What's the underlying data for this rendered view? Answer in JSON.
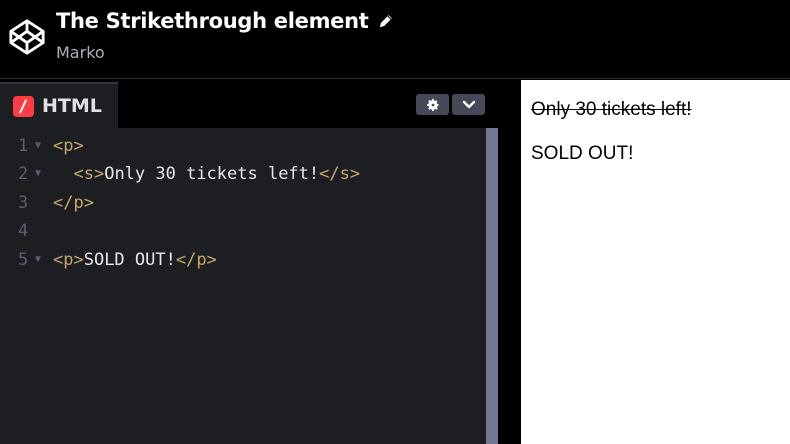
{
  "header": {
    "title": "The Strikethrough element",
    "author": "Marko",
    "logo_icon": "codepen-logo-icon",
    "edit_icon": "pencil-icon"
  },
  "editor": {
    "tab_label": "HTML",
    "tab_icon": "html-tab-icon",
    "settings_icon": "gear-icon",
    "collapse_icon": "chevron-down-icon",
    "lines": [
      {
        "num": "1",
        "fold": "▼",
        "open": "<p>",
        "text": "",
        "close": ""
      },
      {
        "num": "2",
        "fold": "▼",
        "indent": "  ",
        "open": "<s>",
        "text": "Only 30 tickets left!",
        "close": "</s>"
      },
      {
        "num": "3",
        "fold": "",
        "open": "</p>",
        "text": "",
        "close": ""
      },
      {
        "num": "4",
        "fold": "",
        "open": "",
        "text": "",
        "close": ""
      },
      {
        "num": "5",
        "fold": "▼",
        "open": "<p>",
        "text": "SOLD OUT!",
        "close": "</p>"
      }
    ]
  },
  "preview": {
    "strike_text": "Only 30 tickets left!",
    "paragraph_text": "SOLD OUT!"
  },
  "colors": {
    "tag": "#c5a86b",
    "text": "#e8e8e8",
    "editor_bg": "#1d1e22",
    "html_icon": "#ff3c41"
  }
}
